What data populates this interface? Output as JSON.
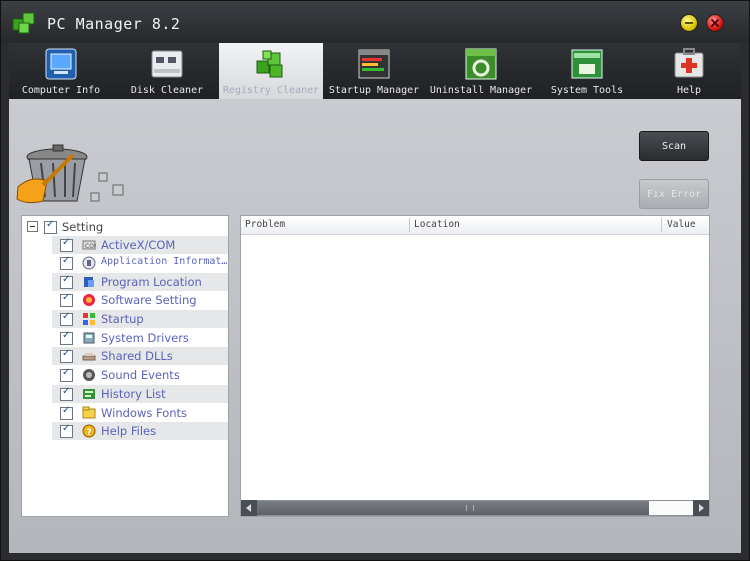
{
  "window": {
    "title": "PC Manager 8.2"
  },
  "tabs": [
    {
      "label": "Computer Info",
      "icon": "monitor-icon"
    },
    {
      "label": "Disk Cleaner",
      "icon": "disk-icon"
    },
    {
      "label": "Registry Cleaner",
      "icon": "registry-cubes-icon",
      "active": true
    },
    {
      "label": "Startup Manager",
      "icon": "startup-window-icon"
    },
    {
      "label": "Uninstall Manager",
      "icon": "soft-uninstall-icon"
    },
    {
      "label": "System Tools",
      "icon": "toolbox-icon"
    },
    {
      "label": "Help",
      "icon": "first-aid-kit-icon"
    }
  ],
  "actions": {
    "scan_label": "Scan",
    "fix_label": "Fix Error"
  },
  "tree": {
    "root_label": "Setting",
    "items": [
      {
        "label": "ActiveX/COM",
        "icon": "activex-icon",
        "checked": true
      },
      {
        "label": "Application Informat…",
        "icon": "application-icon",
        "checked": true
      },
      {
        "label": "Program Location",
        "icon": "program-location-icon",
        "checked": true
      },
      {
        "label": "Software Setting",
        "icon": "software-setting-icon",
        "checked": true
      },
      {
        "label": "Startup",
        "icon": "startup-icon",
        "checked": true
      },
      {
        "label": "System Drivers",
        "icon": "system-drivers-icon",
        "checked": true
      },
      {
        "label": "Shared DLLs",
        "icon": "shared-dlls-icon",
        "checked": true
      },
      {
        "label": "Sound Events",
        "icon": "sound-events-icon",
        "checked": true
      },
      {
        "label": "History List",
        "icon": "history-list-icon",
        "checked": true
      },
      {
        "label": "Windows Fonts",
        "icon": "windows-fonts-icon",
        "checked": true
      },
      {
        "label": "Help Files",
        "icon": "help-files-icon",
        "checked": true
      }
    ]
  },
  "results_table": {
    "columns": [
      "Problem",
      "Location",
      "Value"
    ],
    "rows": []
  },
  "colors": {
    "accent_green": "#4fb52a",
    "tree_text": "#5a63b8",
    "titlebar": "#2a2c2f"
  }
}
